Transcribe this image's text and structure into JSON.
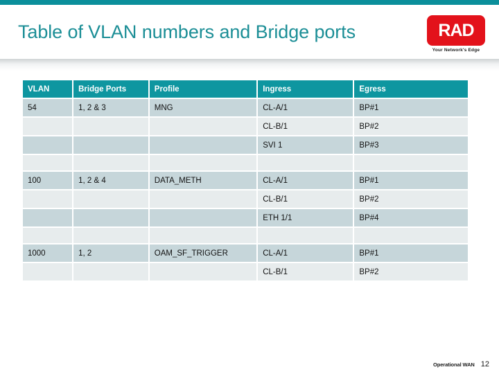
{
  "slide": {
    "title": "Table of VLAN numbers and Bridge ports",
    "accent_color": "#0B8F9B",
    "title_color": "#1B8E96"
  },
  "logo": {
    "name": "rad-logo",
    "text": "RAD",
    "tagline": "Your Network's Edge",
    "color": "#E3121B"
  },
  "table": {
    "name": "vlan-bridge-ports-table",
    "header_color": "#0E96A0",
    "row_dark_color": "#C6D6DA",
    "row_light_color": "#E7ECED",
    "columns": [
      "VLAN",
      "Bridge Ports",
      "Profile",
      "Ingress",
      "Egress"
    ],
    "groups": [
      {
        "vlan": "54",
        "bridge_ports": "1, 2 & 3",
        "profile": "MNG",
        "mappings": [
          {
            "ingress": "CL-A/1",
            "egress": "BP#1"
          },
          {
            "ingress": "CL-B/1",
            "egress": "BP#2"
          },
          {
            "ingress": "SVI 1",
            "egress": "BP#3"
          }
        ]
      },
      {
        "vlan": "100",
        "bridge_ports": "1, 2 & 4",
        "profile": "DATA_METH",
        "mappings": [
          {
            "ingress": "CL-A/1",
            "egress": "BP#1"
          },
          {
            "ingress": "CL-B/1",
            "egress": "BP#2"
          },
          {
            "ingress": "ETH 1/1",
            "egress": "BP#4"
          }
        ]
      },
      {
        "vlan": "1000",
        "bridge_ports": "1, 2",
        "profile": "OAM_SF_TRIGGER",
        "mappings": [
          {
            "ingress": "CL-A/1",
            "egress": "BP#1"
          },
          {
            "ingress": "CL-B/1",
            "egress": "BP#2"
          }
        ]
      }
    ]
  },
  "footer": {
    "label": "Operational WAN",
    "page": "12"
  }
}
